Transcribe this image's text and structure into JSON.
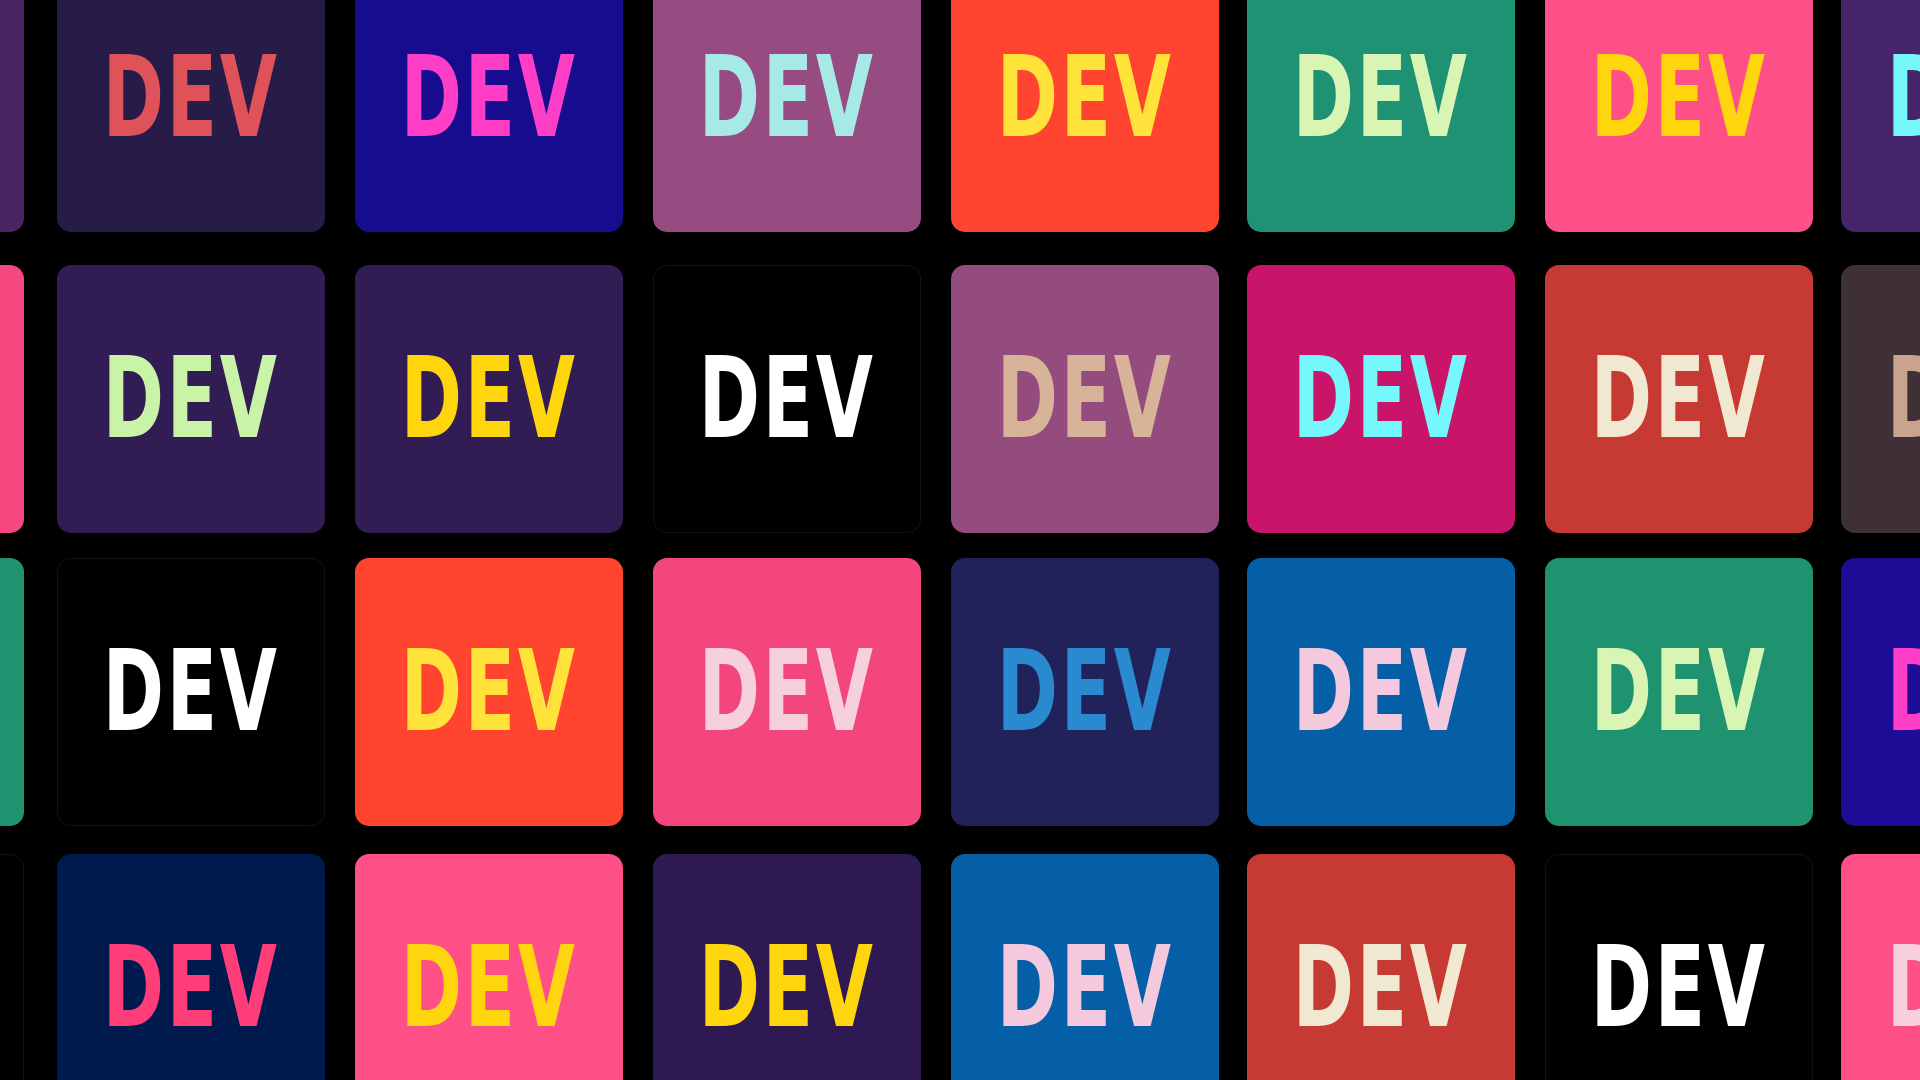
{
  "background_color": "#000000",
  "logo_text": "DEV",
  "rows": [
    [
      {
        "bg": "#4a2566",
        "fg": "#2ed3c3"
      },
      {
        "bg": "#271c48",
        "fg": "#e0525a"
      },
      {
        "bg": "#170b8e",
        "fg": "#ff3ec8"
      },
      {
        "bg": "#964c80",
        "fg": "#a6e9e6"
      },
      {
        "bg": "#ff4530",
        "fg": "#ffe33a"
      },
      {
        "bg": "#1e9272",
        "fg": "#d8f5b3"
      },
      {
        "bg": "#fe5087",
        "fg": "#ffd60d"
      },
      {
        "bg": "#46256b",
        "fg": "#76f7fb"
      }
    ],
    [
      {
        "bg": "#f7477f",
        "fg": "#ffd60d"
      },
      {
        "bg": "#311c54",
        "fg": "#c9f4a7"
      },
      {
        "bg": "#311c54",
        "fg": "#ffd60d"
      },
      {
        "bg": "#000000",
        "fg": "#ffffff"
      },
      {
        "bg": "#934c7d",
        "fg": "#d7b39a"
      },
      {
        "bg": "#c8156a",
        "fg": "#76f7fb"
      },
      {
        "bg": "#c73a33",
        "fg": "#f1e8d1"
      },
      {
        "bg": "#3f3038",
        "fg": "#c8a48c"
      }
    ],
    [
      {
        "bg": "#1f9270",
        "fg": "#d8f5b3"
      },
      {
        "bg": "#000000",
        "fg": "#ffffff"
      },
      {
        "bg": "#ff4530",
        "fg": "#ffe33a"
      },
      {
        "bg": "#f3467c",
        "fg": "#f7d0dd"
      },
      {
        "bg": "#22225a",
        "fg": "#2a8ad0"
      },
      {
        "bg": "#045fa7",
        "fg": "#f4c9de"
      },
      {
        "bg": "#1f9270",
        "fg": "#d8f5b3"
      },
      {
        "bg": "#1c0c96",
        "fg": "#ff3ec8"
      }
    ],
    [
      {
        "bg": "#000000",
        "fg": "#ffffff"
      },
      {
        "bg": "#001a4e",
        "fg": "#ff3d78"
      },
      {
        "bg": "#fe5087",
        "fg": "#ffd60d"
      },
      {
        "bg": "#2e1952",
        "fg": "#ffd60d"
      },
      {
        "bg": "#045fa7",
        "fg": "#f4c9de"
      },
      {
        "bg": "#c73a33",
        "fg": "#f1e8d1"
      },
      {
        "bg": "#000000",
        "fg": "#ffffff"
      },
      {
        "bg": "#fe5087",
        "fg": "#f7d0dd"
      }
    ]
  ]
}
